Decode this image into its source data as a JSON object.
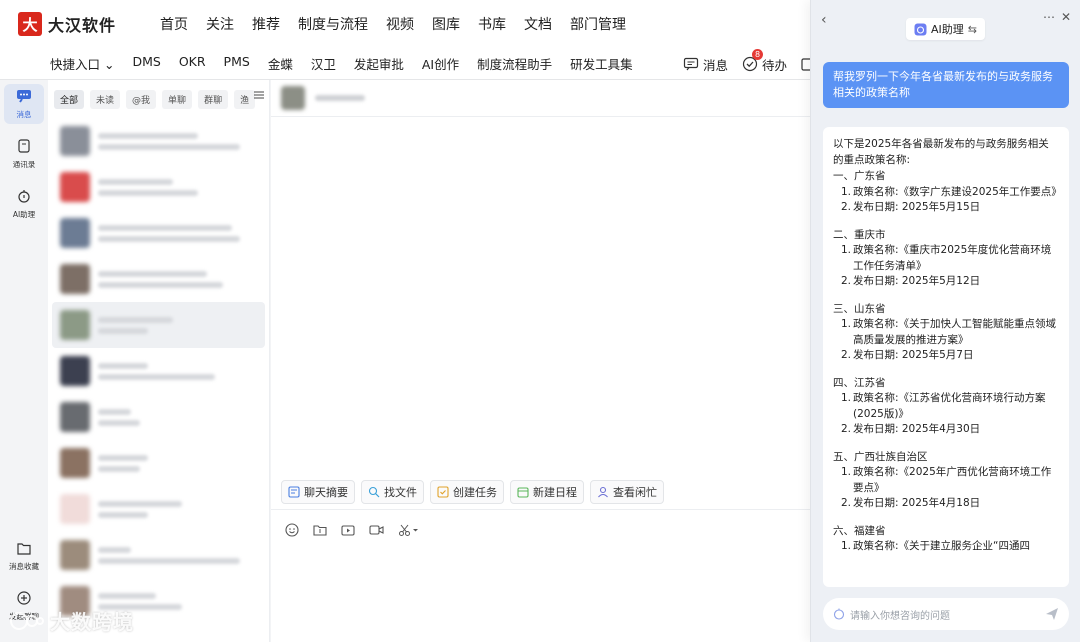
{
  "app": {
    "logo_mark": "大",
    "name": "大汉软件"
  },
  "topnav": [
    "首页",
    "关注",
    "推荐",
    "制度与流程",
    "视频",
    "图库",
    "书库",
    "文档",
    "部门管理"
  ],
  "subnav": [
    "快捷入口 ⌄",
    "DMS",
    "OKR",
    "PMS",
    "金蝶",
    "汉卫",
    "发起审批",
    "AI创作",
    "制度流程助手",
    "研发工具集"
  ],
  "subright": {
    "messages": "消息",
    "todo": "待办",
    "todo_badge": "8"
  },
  "rail": {
    "messages": "消息",
    "contacts": "通讯录",
    "ai": "AI助理",
    "favorites": "消息收藏",
    "new_group": "发起群聊"
  },
  "filters": [
    "全部",
    "未读",
    "@我",
    "单聊",
    "群聊",
    "渔"
  ],
  "chat_actions": [
    "聊天摘要",
    "找文件",
    "创建任务",
    "新建日程",
    "查看闲忙"
  ],
  "ai_panel": {
    "title": "AI助理",
    "user_question": "帮我罗列一下今年各省最新发布的与政务服务相关的政策名称",
    "intro": "以下是2025年各省最新发布的与政务服务相关的重点政策名称:",
    "sections": [
      {
        "heading": "一、广东省",
        "policy": "政策名称:《数字广东建设2025年工作要点》",
        "date": "发布日期: 2025年5月15日"
      },
      {
        "heading": "二、重庆市",
        "policy": "政策名称:《重庆市2025年度优化营商环境工作任务清单》",
        "date": "发布日期: 2025年5月12日"
      },
      {
        "heading": "三、山东省",
        "policy": "政策名称:《关于加快人工智能赋能重点领域高质量发展的推进方案》",
        "date": "发布日期: 2025年5月7日"
      },
      {
        "heading": "四、江苏省",
        "policy": "政策名称:《江苏省优化营商环境行动方案(2025版)》",
        "date": "发布日期: 2025年4月30日"
      },
      {
        "heading": "五、广西壮族自治区",
        "policy": "政策名称:《2025年广西优化营商环境工作要点》",
        "date": "发布日期: 2025年4月18日"
      },
      {
        "heading": "六、福建省",
        "policy": "政策名称:《关于建立服务企业“四通四",
        "date": ""
      }
    ],
    "input_placeholder": "请输入你想咨询的问题"
  },
  "watermark": "大数跨境"
}
